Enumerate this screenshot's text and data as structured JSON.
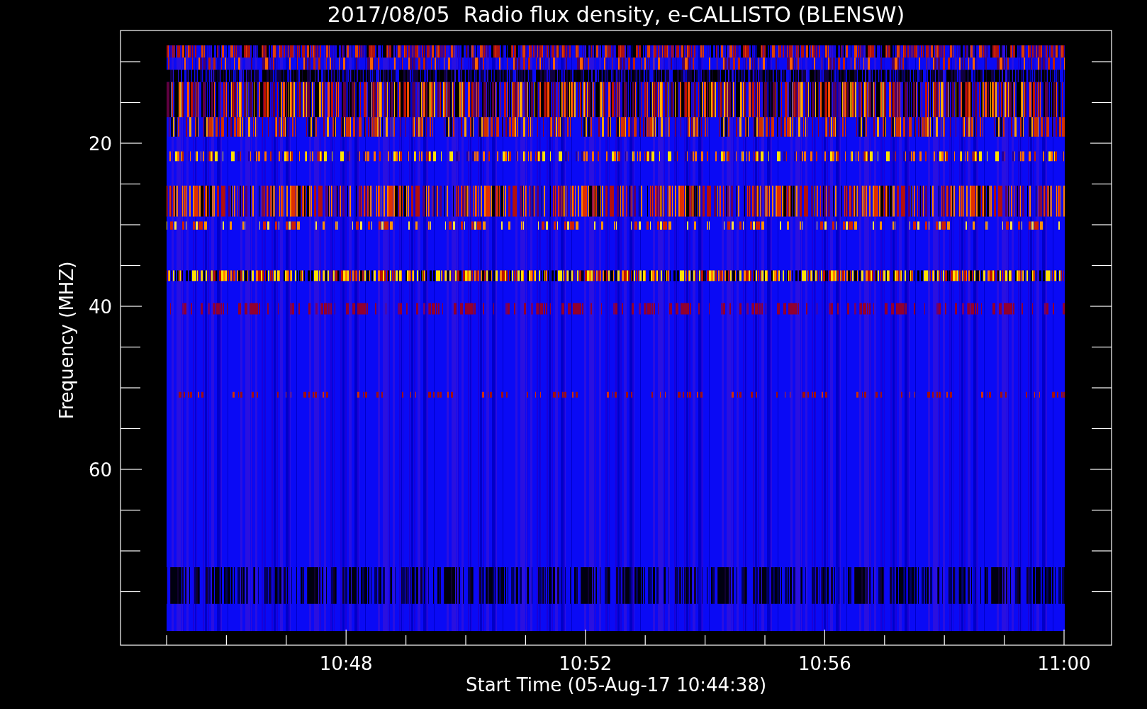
{
  "title": "2017/08/05  Radio flux density, e-CALLISTO (BLENSW)",
  "y_axis": {
    "label": "Frequency (MHZ)",
    "ticks": [
      "20",
      "40",
      "60"
    ]
  },
  "x_axis": {
    "label": "Start Time (05-Aug-17 10:44:38)",
    "ticks": [
      "10:48",
      "10:52",
      "10:56",
      "11:00"
    ]
  }
}
